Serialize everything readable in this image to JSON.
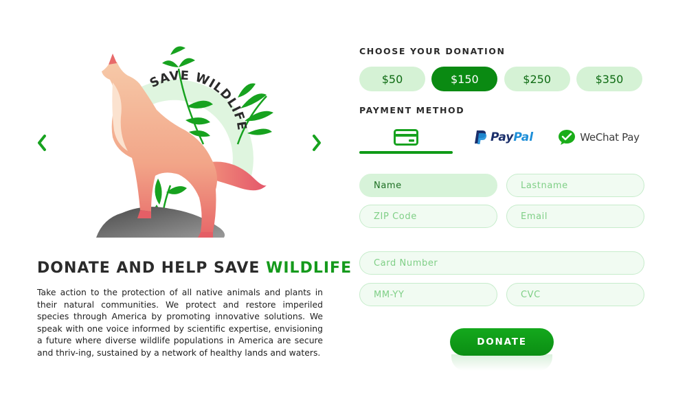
{
  "carousel": {
    "prev_icon": "chevron-left-icon",
    "next_icon": "chevron-right-icon",
    "badge_text": "SAVE WILDLIFE"
  },
  "headline": {
    "main": "DONATE AND HELP SAVE",
    "accent": "WILDLIFE"
  },
  "description": "Take action to the protection of all native animals and plants in their natural communities. We protect and restore imperiled species through America by promoting innovative solutions. We speak with one voice informed by scientific expertise, envisioning a future where diverse wildlife populations in America are secure and thriv-ing, sustained by a network of healthy lands and waters.",
  "donation": {
    "label": "CHOOSE YOUR DONATION",
    "amounts": [
      "$50",
      "$150",
      "$250",
      "$350"
    ],
    "selected": "$150"
  },
  "payment": {
    "label": "PAYMENT METHOD",
    "methods": [
      {
        "name": "card",
        "icon": "credit-card-icon"
      },
      {
        "name": "PayPal",
        "icon": "paypal-logo-icon",
        "text_1": "Pay",
        "text_2": "Pal"
      },
      {
        "name": "WeChat Pay",
        "icon": "wechat-logo-icon",
        "text": "WeChat Pay"
      }
    ],
    "selected": "card"
  },
  "form": {
    "name": "Name",
    "lastname": "Lastname",
    "zip": "ZIP Code",
    "email": "Email",
    "card_number": "Card Number",
    "expiry": "MM-YY",
    "cvc": "CVC"
  },
  "donate_button": "DONATE",
  "colors": {
    "brand_green": "#0a8a12",
    "accent_green": "#159a1c",
    "pill_light": "#d5f2d5",
    "field_bg": "#f1fbf2",
    "field_border": "#c6eccb",
    "placeholder": "#7fcf86"
  }
}
